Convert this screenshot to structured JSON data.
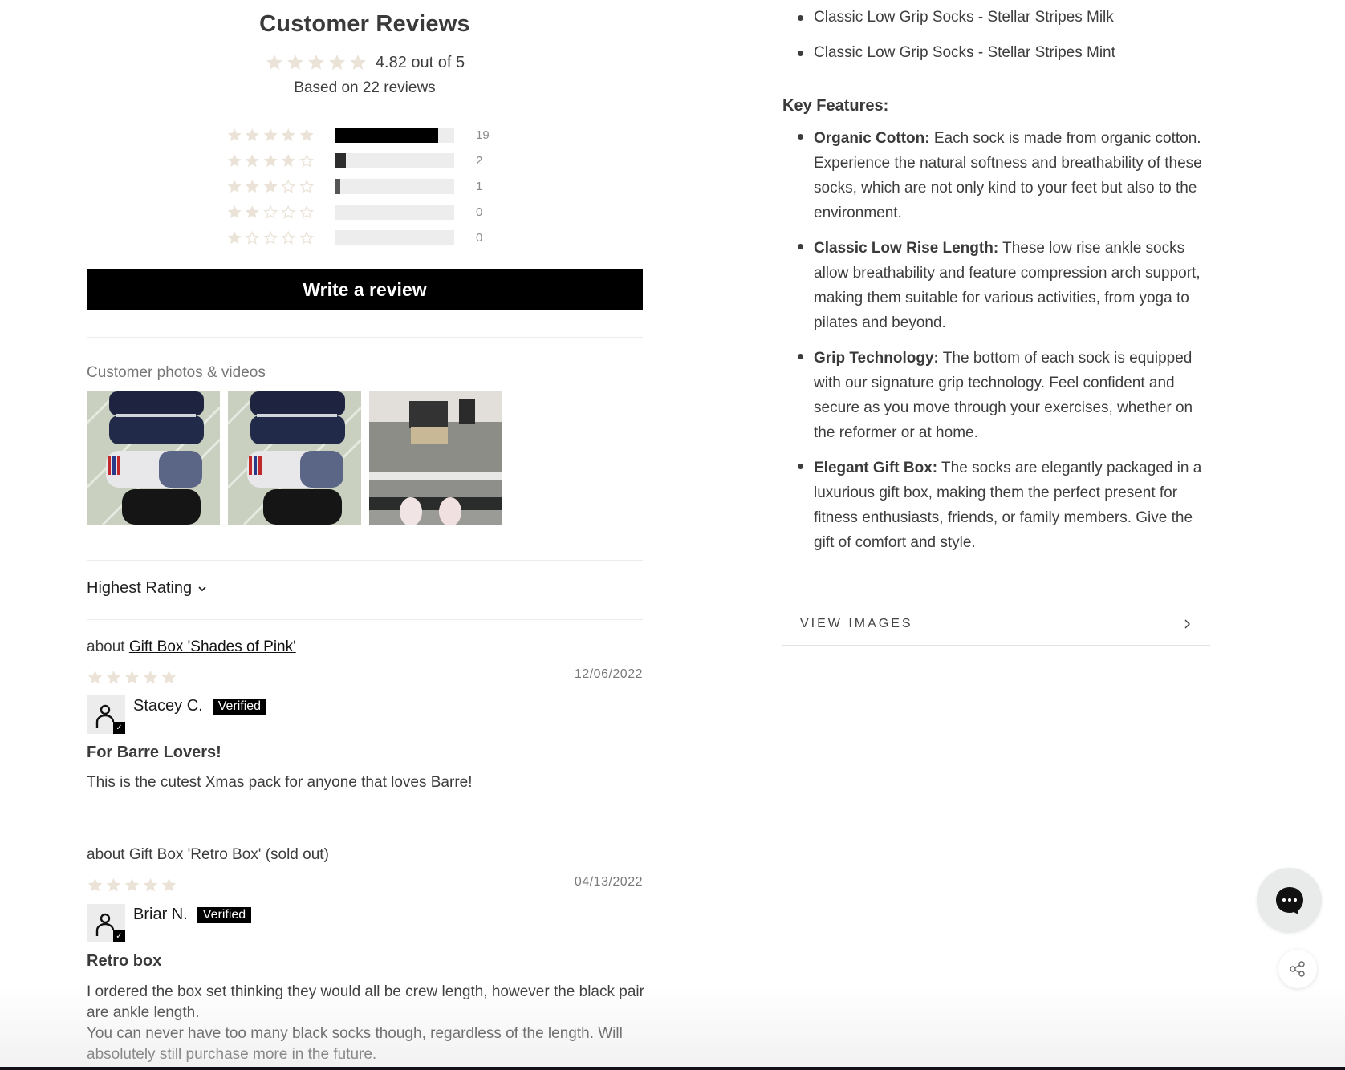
{
  "reviews": {
    "title": "Customer Reviews",
    "average_rating": 4.82,
    "average_text": "4.82 out of 5",
    "based_on": "Based on 22 reviews",
    "star_color": "#ebe3d8",
    "histogram": [
      {
        "stars": 5,
        "count": 19,
        "count_text": "19",
        "fraction": 0.864,
        "fill_color": "#000000"
      },
      {
        "stars": 4,
        "count": 2,
        "count_text": "2",
        "fraction": 0.091,
        "fill_color": "#2d2d2d"
      },
      {
        "stars": 3,
        "count": 1,
        "count_text": "1",
        "fraction": 0.045,
        "fill_color": "#555555"
      },
      {
        "stars": 2,
        "count": 0,
        "count_text": "0",
        "fraction": 0,
        "fill_color": "#000000"
      },
      {
        "stars": 1,
        "count": 0,
        "count_text": "0",
        "fraction": 0,
        "fill_color": "#000000"
      }
    ],
    "write_review_label": "Write a review",
    "photos_label": "Customer photos & videos",
    "photos": [
      {
        "alt": "Sock pairs laid on bed - navy, white, black"
      },
      {
        "alt": "Sock pairs laid on bed - navy, white, black"
      },
      {
        "alt": "Feet in socks on pilates reformer"
      }
    ],
    "sort_label": "Highest Rating",
    "items": [
      {
        "about_prefix": "about ",
        "about_product": "Gift Box 'Shades of Pink'",
        "about_is_link": true,
        "rating": 5,
        "date": "12/06/2022",
        "author": "Stacey C.",
        "badge": "Verified",
        "title": "For Barre Lovers!",
        "body": [
          "This is the cutest Xmas pack for anyone that loves Barre!"
        ]
      },
      {
        "about_prefix": "about ",
        "about_product": "Gift Box 'Retro Box' (sold out)",
        "about_is_link": false,
        "rating": 5,
        "date": "04/13/2022",
        "author": "Briar N.",
        "badge": "Verified",
        "title": "Retro box",
        "body": [
          "I ordered the box set thinking they would all be crew length, however the black pair are ankle length.",
          "You can never have too many black socks though, regardless of the length. Will absolutely still purchase more in the future."
        ]
      }
    ]
  },
  "product": {
    "included_items": [
      "Classic Low Grip Socks - Stellar Stripes Milk",
      "Classic Low Grip Socks - Stellar Stripes Mint"
    ],
    "key_features_heading": "Key Features:",
    "features": [
      {
        "name": "Organic Cotton:",
        "text": " Each sock is made from organic cotton. Experience the natural softness and breathability of these socks, which are not only kind to your feet but also to the environment."
      },
      {
        "name": "Classic Low Rise Length:",
        "text": " These low rise ankle socks allow breathability and feature compression arch support, making them suitable for various activities, from yoga to pilates and beyond."
      },
      {
        "name": "Grip Technology:",
        "text": " The bottom of each sock is equipped with our signature grip technology. Feel confident and secure as you move through your exercises, whether on the reformer or at home."
      },
      {
        "name": "Elegant Gift Box:",
        "text": " The socks are elegantly packaged in a luxurious gift box, making them the perfect present for fitness enthusiasts, friends, or family members. Give the gift of comfort and style."
      }
    ],
    "view_images_label": "VIEW IMAGES"
  },
  "floating": {
    "chat_icon": "chat-bubble-icon",
    "share_icon": "share-icon"
  }
}
